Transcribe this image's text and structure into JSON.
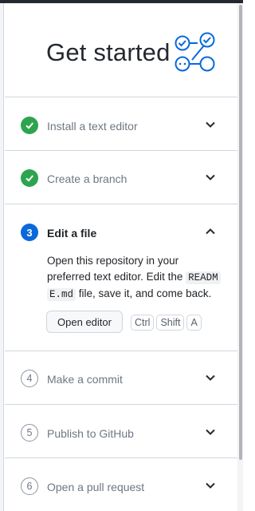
{
  "header": {
    "title": "Get started",
    "graphic_icon": "workflow-checklist-icon"
  },
  "steps": [
    {
      "state": "completed",
      "label": "Install a text editor",
      "icon": "check-circle-icon",
      "expanded": false
    },
    {
      "state": "completed",
      "label": "Create a branch",
      "icon": "check-circle-icon",
      "expanded": false
    },
    {
      "state": "current",
      "number": "3",
      "label": "Edit a file",
      "expanded": true,
      "description_line1": "Open this repository in your",
      "description_line2": "preferred text editor. Edit the",
      "code_part1": "READM",
      "code_part2": "E.md",
      "description_line3_rest": " file, save it, and come back.",
      "button_label": "Open editor",
      "shortcut_keys": [
        "Ctrl",
        "Shift",
        "A"
      ]
    },
    {
      "state": "todo",
      "number": "4",
      "label": "Make a commit",
      "expanded": false
    },
    {
      "state": "todo",
      "number": "5",
      "label": "Publish to GitHub",
      "expanded": false
    },
    {
      "state": "todo",
      "number": "6",
      "label": "Open a pull request",
      "expanded": false
    }
  ],
  "colors": {
    "completed": "#2da44e",
    "current": "#0969da",
    "graphic": "#0969da",
    "border": "#d0d7de"
  }
}
